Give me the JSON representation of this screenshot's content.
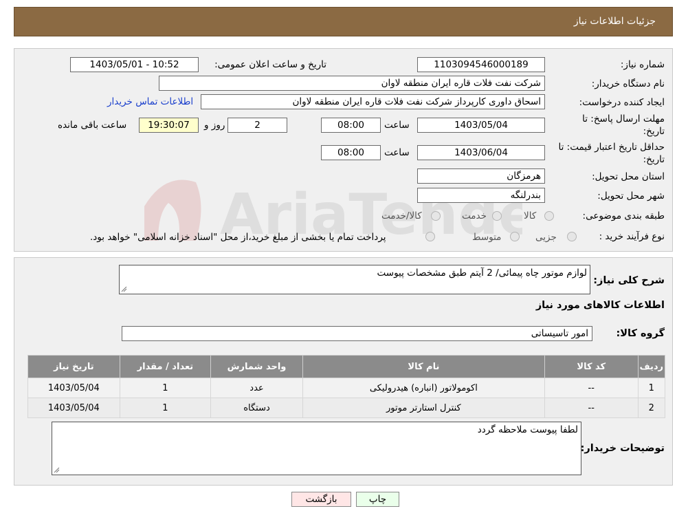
{
  "header": {
    "title": "جزئیات اطلاعات نیاز"
  },
  "details": {
    "need_number_label": "شماره نیاز:",
    "need_number": "1103094546000189",
    "announce_label": "تاریخ و ساعت اعلان عمومی:",
    "announce_value": "1403/05/01 - 10:52",
    "buyer_org_label": "نام دستگاه خریدار:",
    "buyer_org": "شرکت نفت فلات قاره ایران منطقه لاوان",
    "requester_label": "ایجاد کننده درخواست:",
    "requester": "اسحاق داوری کارپرداز شرکت نفت فلات قاره ایران منطقه لاوان",
    "contact_link": "اطلاعات تماس خریدار",
    "deadline_label_1": "مهلت ارسال پاسخ: تا",
    "deadline_label_2": "تاریخ:",
    "deadline_date": "1403/05/04",
    "time_label": "ساعت",
    "deadline_time": "08:00",
    "days_value": "2",
    "days_label": "روز و",
    "remaining_time": "19:30:07",
    "remaining_label": "ساعت باقی مانده",
    "validity_label_1": "حداقل تاریخ اعتبار قیمت: تا",
    "validity_label_2": "تاریخ:",
    "validity_date": "1403/06/04",
    "validity_time": "08:00",
    "province_label": "استان محل تحویل:",
    "province": "هرمزگان",
    "city_label": "شهر محل تحویل:",
    "city": "بندرلنگه",
    "category_label": "طبقه بندی موضوعی:",
    "category_options": [
      "کالا",
      "خدمت",
      "کالا/خدمت"
    ],
    "process_label": "نوع فرآیند خرید :",
    "process_options": [
      "جزیی",
      "متوسط"
    ],
    "process_note": "پرداخت تمام یا بخشی از مبلغ خرید،از محل \"اسناد خزانه اسلامی\" خواهد بود."
  },
  "description": {
    "label": "شرح کلی نیاز:",
    "value": "لوازم موتور چاه پیمائی/ 2 آیتم طبق مشخصات پیوست"
  },
  "goods": {
    "section_title": "اطلاعات کالاهای مورد نیاز",
    "group_label": "گروه کالا:",
    "group_value": "امور تاسیساتی",
    "columns": [
      "ردیف",
      "کد کالا",
      "نام کالا",
      "واحد شمارش",
      "تعداد / مقدار",
      "تاریخ نیاز"
    ],
    "rows": [
      [
        "1",
        "--",
        "اکومولاتور (انباره) هیدرولیکی",
        "عدد",
        "1",
        "1403/05/04"
      ],
      [
        "2",
        "--",
        "کنترل استارتر موتور",
        "دستگاه",
        "1",
        "1403/05/04"
      ]
    ]
  },
  "buyer_notes": {
    "label": "توضیحات خریدار:",
    "value": "لطفا پیوست ملاحظه گردد"
  },
  "buttons": {
    "print": "چاپ",
    "back": "بازگشت"
  },
  "colors": {
    "header": "#8b6a43",
    "table_header": "#8b8b8b",
    "print_button": "#eaffea",
    "back_button": "#ffe6e6"
  }
}
